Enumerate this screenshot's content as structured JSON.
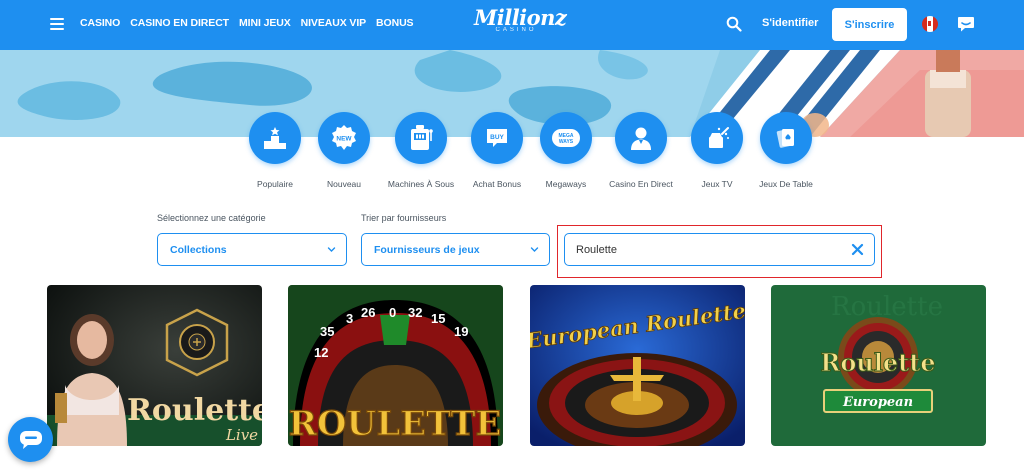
{
  "header": {
    "nav": [
      "CASINO",
      "CASINO EN DIRECT",
      "MINI JEUX",
      "NIVEAUX VIP",
      "BONUS"
    ],
    "logo_text": "Millionz",
    "logo_sub": "CASINO",
    "login_label": "S'identifier",
    "signup_label": "S'inscrire",
    "brand_color": "#1e8ff0"
  },
  "categories": [
    {
      "label": "Populaire",
      "icon": "podium-icon"
    },
    {
      "label": "Nouveau",
      "icon": "new-badge-icon"
    },
    {
      "label": "Machines À Sous",
      "icon": "slot-machine-icon"
    },
    {
      "label": "Achat Bonus",
      "icon": "buy-icon"
    },
    {
      "label": "Megaways",
      "icon": "megaways-icon"
    },
    {
      "label": "Casino En Direct",
      "icon": "dealer-icon"
    },
    {
      "label": "Jeux TV",
      "icon": "tv-icon"
    },
    {
      "label": "Jeux De Table",
      "icon": "cards-icon"
    }
  ],
  "filters": {
    "category_label": "Sélectionnez une catégorie",
    "category_value": "Collections",
    "provider_label": "Trier par fournisseurs",
    "provider_value": "Fournisseurs de jeux",
    "search_value": "Roulette"
  },
  "games": [
    {
      "title": "Roulette",
      "subtitle": "Live"
    },
    {
      "title": "ROULETTE",
      "numbers": [
        "12",
        "35",
        "3",
        "26",
        "0",
        "32",
        "15",
        "19"
      ]
    },
    {
      "title": "European Roulette"
    },
    {
      "title": "Roulette",
      "subtitle": "European"
    }
  ]
}
